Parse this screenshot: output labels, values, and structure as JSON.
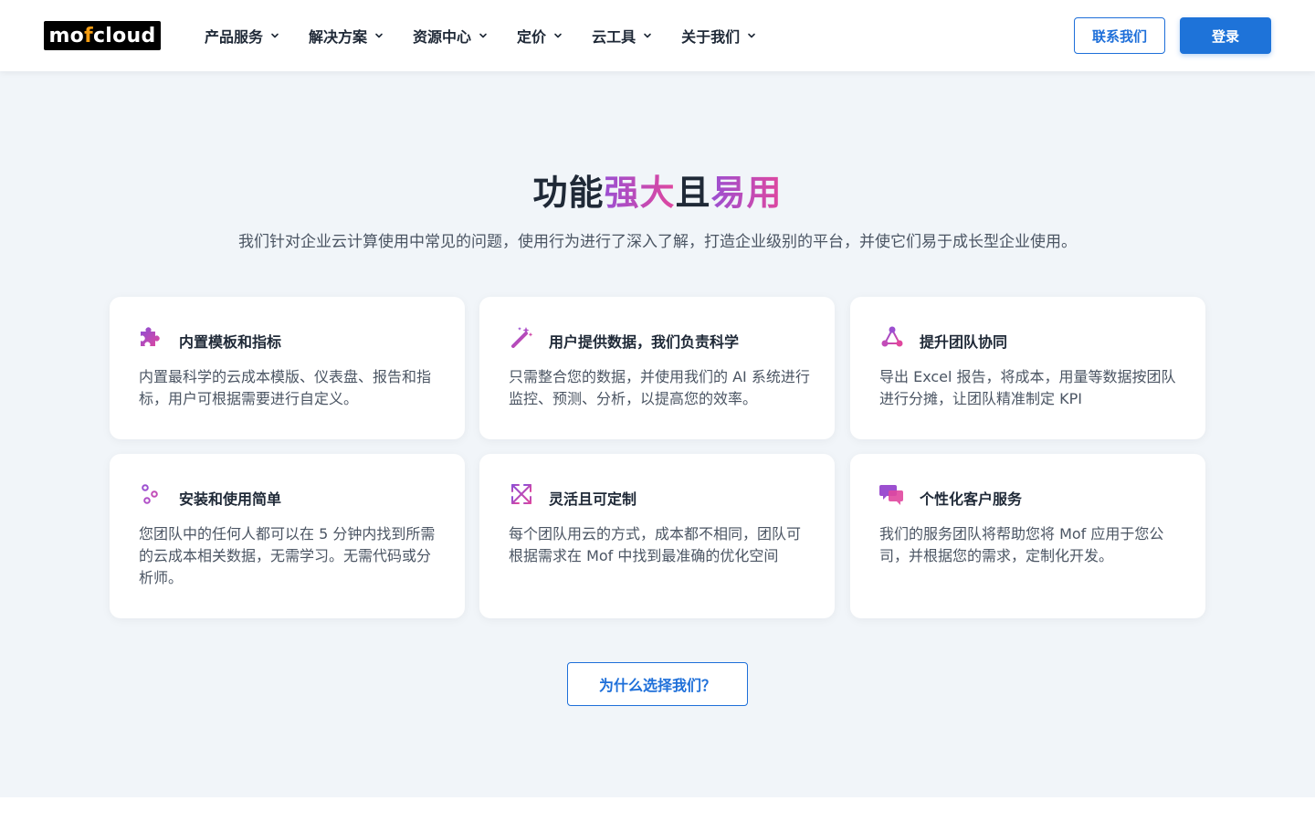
{
  "brand": {
    "logo_prefix": "mo",
    "logo_accent": "f",
    "logo_suffix": "cloud",
    "accent_color": "#f39c12"
  },
  "nav": {
    "items": [
      {
        "label": "产品服务",
        "icon": "chevron-down-icon"
      },
      {
        "label": "解决方案",
        "icon": "chevron-down-icon"
      },
      {
        "label": "资源中心",
        "icon": "chevron-down-icon"
      },
      {
        "label": "定价",
        "icon": "chevron-down-icon"
      },
      {
        "label": "云工具",
        "icon": "chevron-down-icon"
      },
      {
        "label": "关于我们",
        "icon": "chevron-down-icon"
      }
    ],
    "contact_label": "联系我们",
    "login_label": "登录"
  },
  "hero": {
    "title_part1": "功能",
    "title_part2": "强大",
    "title_part3": "且",
    "title_part4": "易用",
    "subtitle": "我们针对企业云计算使用中常见的问题，使用行为进行了深入了解，打造企业级别的平台，并使它们易于成长型企业使用。"
  },
  "features": [
    {
      "icon": "puzzle-icon",
      "title": "内置模板和指标",
      "desc": "内置最科学的云成本模版、仪表盘、报告和指标，用户可根据需要进行自定义。"
    },
    {
      "icon": "magic-wand-icon",
      "title": "用户提供数据，我们负责科学",
      "desc": "只需整合您的数据，并使用我们的 AI 系统进行监控、预测、分析，以提高您的效率。"
    },
    {
      "icon": "network-icon",
      "title": "提升团队协同",
      "desc": "导出 Excel 报告，将成本，用量等数据按团队进行分摊，让团队精准制定 KPI"
    },
    {
      "icon": "sliders-icon",
      "title": "安装和使用简单",
      "desc": "您团队中的任何人都可以在 5 分钟内找到所需的云成本相关数据，无需学习。无需代码或分析师。"
    },
    {
      "icon": "expand-arrows-icon",
      "title": "灵活且可定制",
      "desc": "每个团队用云的方式，成本都不相同，团队可根据需求在 Mof 中找到最准确的优化空间"
    },
    {
      "icon": "chat-bubbles-icon",
      "title": "个性化客户服务",
      "desc": "我们的服务团队将帮助您将 Mof 应用于您公司，并根据您的需求，定制化开发。"
    }
  ],
  "cta": {
    "why_label": "为什么选择我们？"
  },
  "colors": {
    "primary": "#1e73d9",
    "gradient_start": "#9b4fd1",
    "gradient_end": "#e0479e",
    "section_bg": "#f1f5f9"
  }
}
